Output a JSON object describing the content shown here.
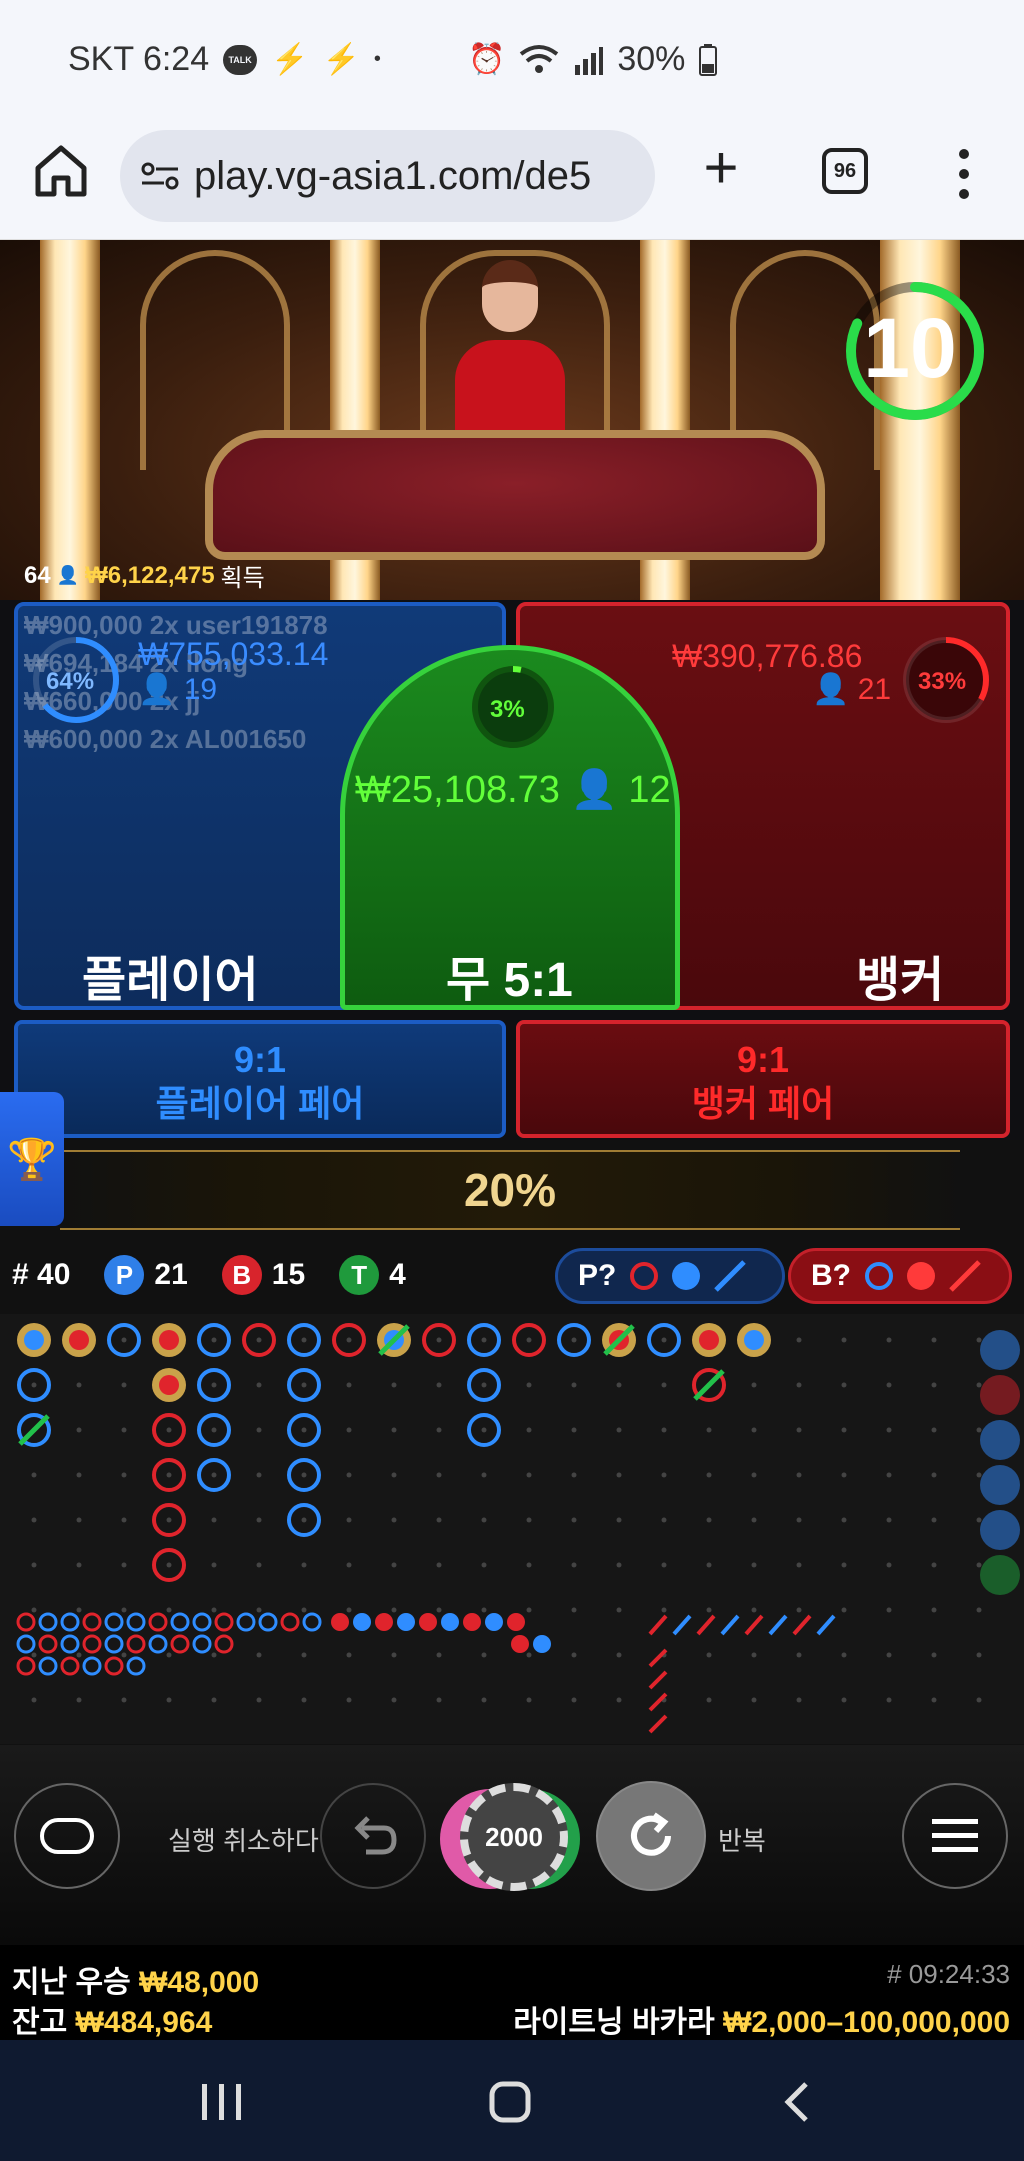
{
  "status": {
    "carrier_time": "SKT 6:24",
    "talk_badge": "TALK",
    "battery": "30%"
  },
  "browser": {
    "url": "play.vg-asia1.com/de5",
    "tab_count": "96"
  },
  "video": {
    "timer": "10",
    "winners_count": "64",
    "winners_amount": "₩6,122,475",
    "winners_suffix": "획득"
  },
  "player": {
    "title": "플레이어",
    "percent": "64%",
    "pool": "₩755,033.14",
    "players": "19",
    "leaderboard": [
      "₩900,000 2x user191878",
      "₩694,184 2x llong",
      "₩660,000 2x jj",
      "₩600,000 2x AL001650"
    ]
  },
  "tie": {
    "title": "무 5:1",
    "percent": "3%",
    "pool": "₩25,108.73",
    "players": "12"
  },
  "banker": {
    "title": "뱅커",
    "percent": "33%",
    "pool": "₩390,776.86",
    "players": "21"
  },
  "player_pair": {
    "odds": "9:1",
    "label": "플레이어 페어"
  },
  "banker_pair": {
    "odds": "9:1",
    "label": "뱅커 페어"
  },
  "multiplier": "20%",
  "stats": {
    "round_label": "# 40",
    "player_badge": "P",
    "player_count": "21",
    "banker_badge": "B",
    "banker_count": "15",
    "tie_badge": "T",
    "tie_count": "4",
    "predict_player": "P?",
    "predict_banker": "B?"
  },
  "controls": {
    "undo_label": "실행 취소하다",
    "chip_value": "2000",
    "repeat_label": "반복"
  },
  "footer": {
    "last_win_label": "지난 우승",
    "last_win_value": "₩48,000",
    "balance_label": "잔고",
    "balance_value": "₩484,964",
    "game_id": "# 09:24:33",
    "game_name": "라이트닝 바카라",
    "limits": "₩2,000–100,000,000"
  },
  "colors": {
    "player_blue": "#2f8dff",
    "banker_red": "#e0242c",
    "tie_green": "#36d23c",
    "gold": "#ffd34a"
  }
}
